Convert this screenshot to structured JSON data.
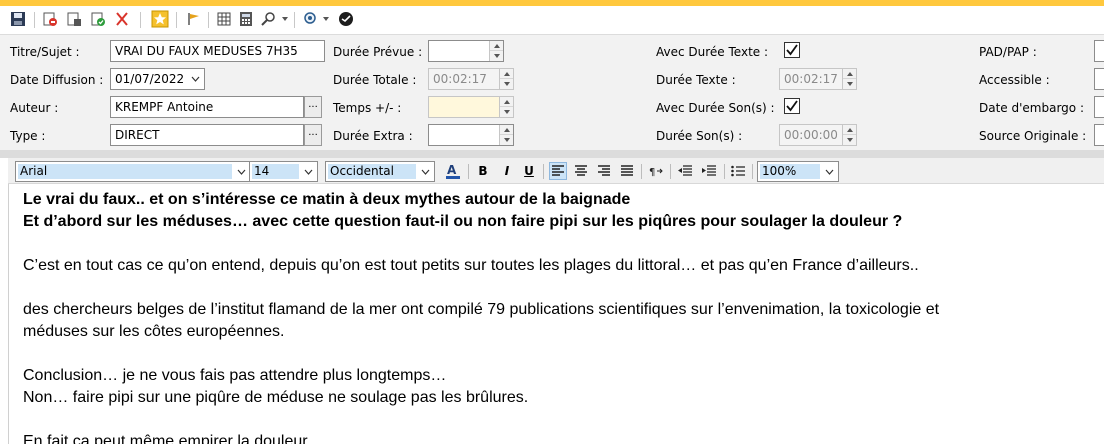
{
  "toolbar": {
    "icons": [
      "save-icon",
      "delete-icon",
      "print-icon",
      "check-icon",
      "scissors-icon",
      "star-icon",
      "flag-icon",
      "grid-icon",
      "calculator-icon",
      "zoom-icon",
      "search-icon",
      "spell-icon"
    ]
  },
  "form": {
    "titre": {
      "label": "Titre/Sujet :",
      "value": "VRAI DU FAUX MEDUSES 7H35"
    },
    "date_diffusion": {
      "label": "Date Diffusion :",
      "value": "01/07/2022"
    },
    "auteur": {
      "label": "Auteur :",
      "value": "KREMPF Antoine",
      "button": "..."
    },
    "type": {
      "label": "Type :",
      "value": "DIRECT",
      "button": "..."
    },
    "duree_prevue": {
      "label": "Durée Prévue :",
      "value": ""
    },
    "duree_totale": {
      "label": "Durée Totale :",
      "value": "00:02:17"
    },
    "temps": {
      "label": "Temps +/- :",
      "value": ""
    },
    "duree_extra": {
      "label": "Durée Extra :",
      "value": ""
    },
    "avec_duree_texte": {
      "label": "Avec Durée Texte :",
      "checked": true
    },
    "duree_texte": {
      "label": "Durée Texte :",
      "value": "00:02:17"
    },
    "avec_duree_sons": {
      "label": "Avec Durée Son(s) :",
      "checked": true
    },
    "duree_sons": {
      "label": "Durée Son(s) :",
      "value": "00:00:00"
    },
    "pad_pap": {
      "label": "PAD/PAP :"
    },
    "accessible": {
      "label": "Accessible :"
    },
    "date_embargo": {
      "label": "Date d'embargo :"
    },
    "source_originale": {
      "label": "Source Originale :"
    }
  },
  "editor_toolbar": {
    "font": "Arial",
    "size": "14",
    "charset": "Occidental",
    "bold": "B",
    "italic": "I",
    "underline": "U",
    "zoom": "100%"
  },
  "editor": {
    "paragraphs": [
      "Le vrai du faux..  et on s’intéresse ce matin à deux mythes autour de la baignade",
      "Et d’abord sur les méduses… avec cette question faut-il ou non faire pipi sur les piqûres pour soulager la douleur ?",
      "C’est en tout cas ce qu’on entend, depuis qu’on est tout petits sur toutes les plages du littoral… et pas qu’en France d’ailleurs..",
      "des chercheurs belges de l’institut flamand de la mer ont compilé 79 publications scientifiques sur l’envenimation, la toxicologie et",
      "méduses sur les côtes européennes.",
      "Conclusion… je ne vous fais pas attendre plus longtemps…",
      "Non… faire pipi sur une piqûre de méduse ne soulage pas les brûlures.",
      "En fait ça peut même empirer la douleur"
    ]
  },
  "colors": {
    "accent_bar": "#ffc83d",
    "selection": "#cce4f7"
  }
}
